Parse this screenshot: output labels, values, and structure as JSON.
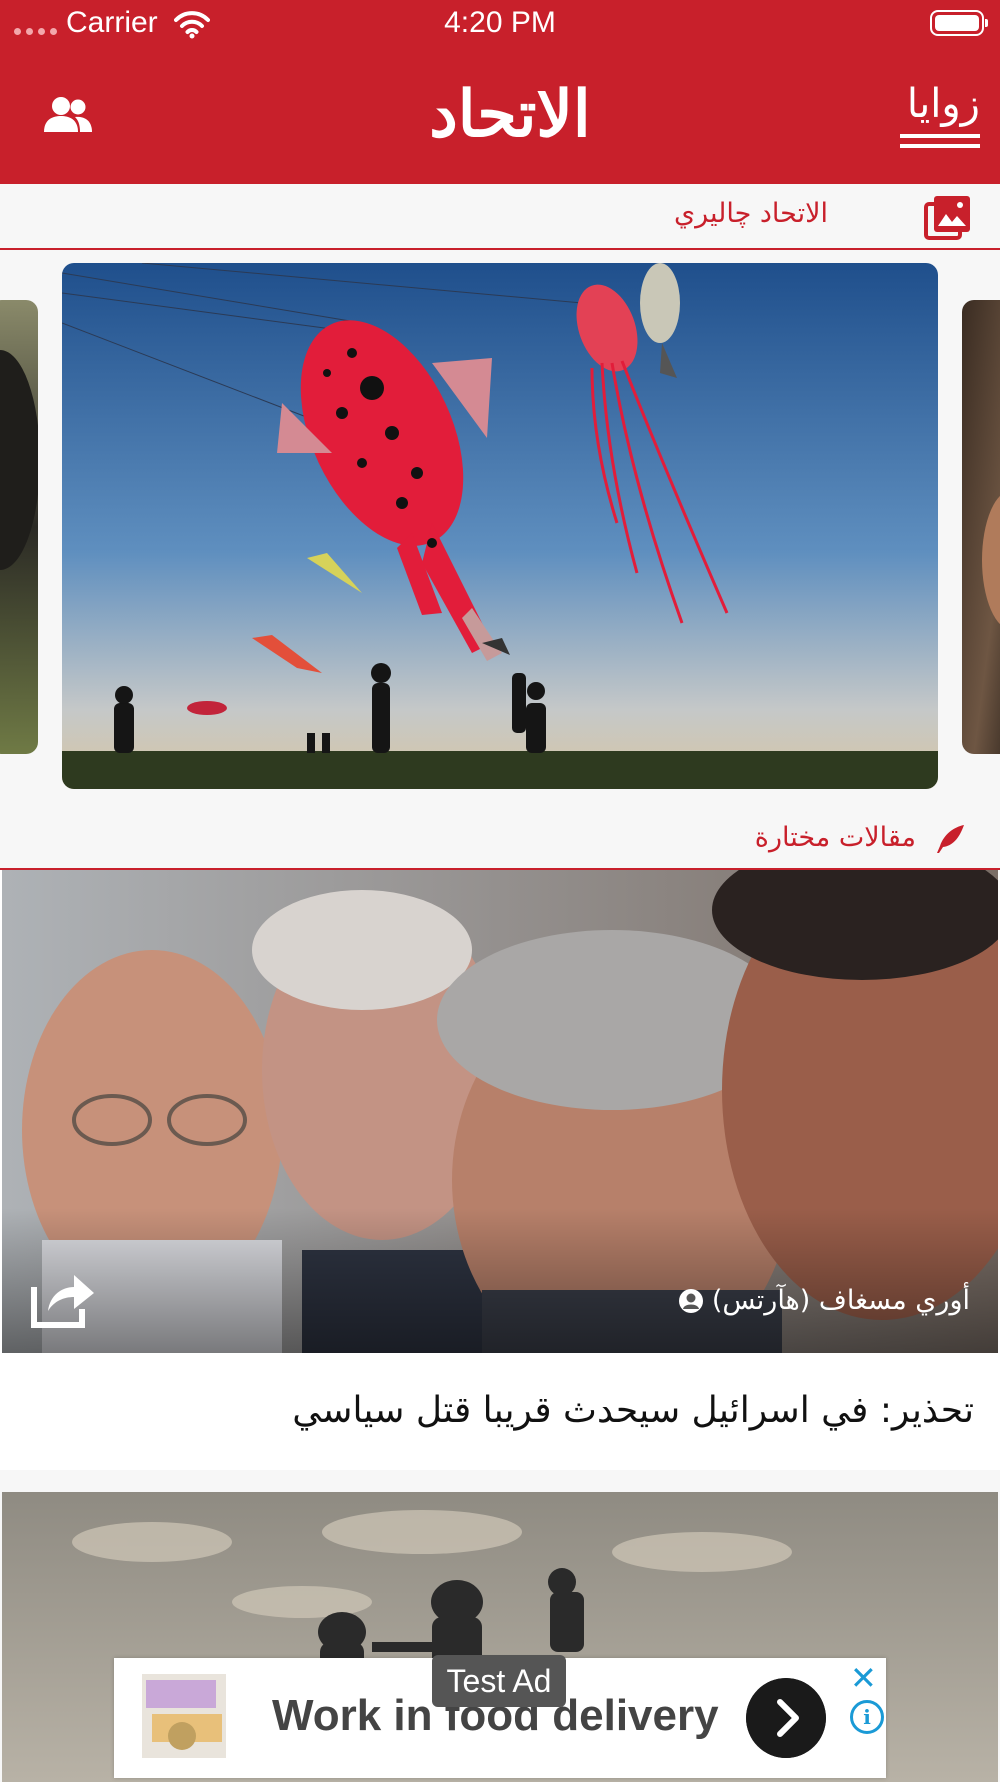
{
  "status_bar": {
    "carrier": "Carrier",
    "time": "4:20 PM"
  },
  "header": {
    "logo_text": "الاتحاد",
    "menu_label": "زوايا"
  },
  "sections": {
    "gallery_title": "الاتحاد چاليري",
    "featured_title": "مقالات مختارة"
  },
  "article": {
    "author": "أوري مسغاف (هآرتس)",
    "title": "تحذير: في اسرائيل سيحدث قريبا قتل سياسي"
  },
  "ad": {
    "badge": "Test Ad",
    "headline": "Work in food delivery",
    "close_glyph": "✕",
    "info_glyph": "i"
  },
  "colors": {
    "brand_red": "#c8202b",
    "ad_blue": "#1a9ad6"
  }
}
